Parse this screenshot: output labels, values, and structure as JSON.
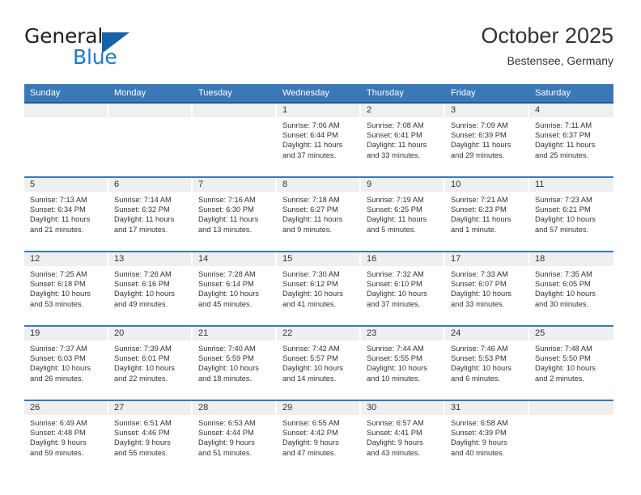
{
  "brand": {
    "name_top": "General",
    "name_bottom": "Blue",
    "accent_color": "#1d7ac4",
    "triangle_color": "#1862ab"
  },
  "header": {
    "title": "October 2025",
    "subtitle": "Bestensee, Germany",
    "header_bg": "#3b78b8",
    "header_rule": "#1a5a96",
    "daynum_band_bg": "#efefef"
  },
  "weekdays": [
    "Sunday",
    "Monday",
    "Tuesday",
    "Wednesday",
    "Thursday",
    "Friday",
    "Saturday"
  ],
  "labels": {
    "sunrise_prefix": "Sunrise:",
    "sunset_prefix": "Sunset:",
    "daylight_prefix": "Daylight:"
  },
  "weeks": [
    [
      {
        "day": "",
        "empty": true
      },
      {
        "day": "",
        "empty": true
      },
      {
        "day": "",
        "empty": true
      },
      {
        "day": "1",
        "sunrise": "Sunrise: 7:06 AM",
        "sunset": "Sunset: 6:44 PM",
        "daylight1": "Daylight: 11 hours",
        "daylight2": "and 37 minutes."
      },
      {
        "day": "2",
        "sunrise": "Sunrise: 7:08 AM",
        "sunset": "Sunset: 6:41 PM",
        "daylight1": "Daylight: 11 hours",
        "daylight2": "and 33 minutes."
      },
      {
        "day": "3",
        "sunrise": "Sunrise: 7:09 AM",
        "sunset": "Sunset: 6:39 PM",
        "daylight1": "Daylight: 11 hours",
        "daylight2": "and 29 minutes."
      },
      {
        "day": "4",
        "sunrise": "Sunrise: 7:11 AM",
        "sunset": "Sunset: 6:37 PM",
        "daylight1": "Daylight: 11 hours",
        "daylight2": "and 25 minutes."
      }
    ],
    [
      {
        "day": "5",
        "sunrise": "Sunrise: 7:13 AM",
        "sunset": "Sunset: 6:34 PM",
        "daylight1": "Daylight: 11 hours",
        "daylight2": "and 21 minutes."
      },
      {
        "day": "6",
        "sunrise": "Sunrise: 7:14 AM",
        "sunset": "Sunset: 6:32 PM",
        "daylight1": "Daylight: 11 hours",
        "daylight2": "and 17 minutes."
      },
      {
        "day": "7",
        "sunrise": "Sunrise: 7:16 AM",
        "sunset": "Sunset: 6:30 PM",
        "daylight1": "Daylight: 11 hours",
        "daylight2": "and 13 minutes."
      },
      {
        "day": "8",
        "sunrise": "Sunrise: 7:18 AM",
        "sunset": "Sunset: 6:27 PM",
        "daylight1": "Daylight: 11 hours",
        "daylight2": "and 9 minutes."
      },
      {
        "day": "9",
        "sunrise": "Sunrise: 7:19 AM",
        "sunset": "Sunset: 6:25 PM",
        "daylight1": "Daylight: 11 hours",
        "daylight2": "and 5 minutes."
      },
      {
        "day": "10",
        "sunrise": "Sunrise: 7:21 AM",
        "sunset": "Sunset: 6:23 PM",
        "daylight1": "Daylight: 11 hours",
        "daylight2": "and 1 minute."
      },
      {
        "day": "11",
        "sunrise": "Sunrise: 7:23 AM",
        "sunset": "Sunset: 6:21 PM",
        "daylight1": "Daylight: 10 hours",
        "daylight2": "and 57 minutes."
      }
    ],
    [
      {
        "day": "12",
        "sunrise": "Sunrise: 7:25 AM",
        "sunset": "Sunset: 6:18 PM",
        "daylight1": "Daylight: 10 hours",
        "daylight2": "and 53 minutes."
      },
      {
        "day": "13",
        "sunrise": "Sunrise: 7:26 AM",
        "sunset": "Sunset: 6:16 PM",
        "daylight1": "Daylight: 10 hours",
        "daylight2": "and 49 minutes."
      },
      {
        "day": "14",
        "sunrise": "Sunrise: 7:28 AM",
        "sunset": "Sunset: 6:14 PM",
        "daylight1": "Daylight: 10 hours",
        "daylight2": "and 45 minutes."
      },
      {
        "day": "15",
        "sunrise": "Sunrise: 7:30 AM",
        "sunset": "Sunset: 6:12 PM",
        "daylight1": "Daylight: 10 hours",
        "daylight2": "and 41 minutes."
      },
      {
        "day": "16",
        "sunrise": "Sunrise: 7:32 AM",
        "sunset": "Sunset: 6:10 PM",
        "daylight1": "Daylight: 10 hours",
        "daylight2": "and 37 minutes."
      },
      {
        "day": "17",
        "sunrise": "Sunrise: 7:33 AM",
        "sunset": "Sunset: 6:07 PM",
        "daylight1": "Daylight: 10 hours",
        "daylight2": "and 33 minutes."
      },
      {
        "day": "18",
        "sunrise": "Sunrise: 7:35 AM",
        "sunset": "Sunset: 6:05 PM",
        "daylight1": "Daylight: 10 hours",
        "daylight2": "and 30 minutes."
      }
    ],
    [
      {
        "day": "19",
        "sunrise": "Sunrise: 7:37 AM",
        "sunset": "Sunset: 6:03 PM",
        "daylight1": "Daylight: 10 hours",
        "daylight2": "and 26 minutes."
      },
      {
        "day": "20",
        "sunrise": "Sunrise: 7:39 AM",
        "sunset": "Sunset: 6:01 PM",
        "daylight1": "Daylight: 10 hours",
        "daylight2": "and 22 minutes."
      },
      {
        "day": "21",
        "sunrise": "Sunrise: 7:40 AM",
        "sunset": "Sunset: 5:59 PM",
        "daylight1": "Daylight: 10 hours",
        "daylight2": "and 18 minutes."
      },
      {
        "day": "22",
        "sunrise": "Sunrise: 7:42 AM",
        "sunset": "Sunset: 5:57 PM",
        "daylight1": "Daylight: 10 hours",
        "daylight2": "and 14 minutes."
      },
      {
        "day": "23",
        "sunrise": "Sunrise: 7:44 AM",
        "sunset": "Sunset: 5:55 PM",
        "daylight1": "Daylight: 10 hours",
        "daylight2": "and 10 minutes."
      },
      {
        "day": "24",
        "sunrise": "Sunrise: 7:46 AM",
        "sunset": "Sunset: 5:53 PM",
        "daylight1": "Daylight: 10 hours",
        "daylight2": "and 6 minutes."
      },
      {
        "day": "25",
        "sunrise": "Sunrise: 7:48 AM",
        "sunset": "Sunset: 5:50 PM",
        "daylight1": "Daylight: 10 hours",
        "daylight2": "and 2 minutes."
      }
    ],
    [
      {
        "day": "26",
        "sunrise": "Sunrise: 6:49 AM",
        "sunset": "Sunset: 4:48 PM",
        "daylight1": "Daylight: 9 hours",
        "daylight2": "and 59 minutes."
      },
      {
        "day": "27",
        "sunrise": "Sunrise: 6:51 AM",
        "sunset": "Sunset: 4:46 PM",
        "daylight1": "Daylight: 9 hours",
        "daylight2": "and 55 minutes."
      },
      {
        "day": "28",
        "sunrise": "Sunrise: 6:53 AM",
        "sunset": "Sunset: 4:44 PM",
        "daylight1": "Daylight: 9 hours",
        "daylight2": "and 51 minutes."
      },
      {
        "day": "29",
        "sunrise": "Sunrise: 6:55 AM",
        "sunset": "Sunset: 4:42 PM",
        "daylight1": "Daylight: 9 hours",
        "daylight2": "and 47 minutes."
      },
      {
        "day": "30",
        "sunrise": "Sunrise: 6:57 AM",
        "sunset": "Sunset: 4:41 PM",
        "daylight1": "Daylight: 9 hours",
        "daylight2": "and 43 minutes."
      },
      {
        "day": "31",
        "sunrise": "Sunrise: 6:58 AM",
        "sunset": "Sunset: 4:39 PM",
        "daylight1": "Daylight: 9 hours",
        "daylight2": "and 40 minutes."
      },
      {
        "day": "",
        "empty": true
      }
    ]
  ]
}
